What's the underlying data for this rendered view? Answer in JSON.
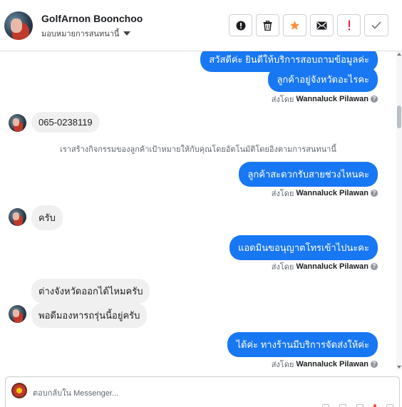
{
  "header": {
    "contact_name": "GolfArnon Boonchoo",
    "assign_label": "มอบหมายการสนทนานี้",
    "actions": [
      {
        "name": "flag-button",
        "glyph": "!",
        "icon": "alert-circle-icon"
      },
      {
        "name": "delete-button",
        "glyph": "🗑",
        "icon": "trash-icon"
      },
      {
        "name": "star-button",
        "glyph": "★",
        "icon": "star-icon"
      },
      {
        "name": "mark-unread-button",
        "glyph": "✉",
        "icon": "envelope-icon"
      },
      {
        "name": "spam-button",
        "glyph": "!",
        "icon": "exclamation-icon"
      },
      {
        "name": "done-button",
        "glyph": "✓",
        "icon": "check-icon"
      }
    ]
  },
  "messages": {
    "m1": "สวัสดีค่ะ  ยินดีให้บริการสอบถามข้อมูลค่ะ",
    "m2": "ลูกค้าอยู่จังหวัดอะไรคะ",
    "m3": "065-0238119",
    "system_note": "เราสร้างกิจกรรมของลูกค้าเป้าหมายให้กับคุณโดยอัตโนมัติโดยอิงตามการสนทนานี้",
    "m4": "ลูกค้าสะดวกรับสายช่วงไหนคะ",
    "m5": "ครับ",
    "m6": "แอดมินขอนุญาตโทรเข้าไปนะคะ",
    "m7": "ต่างจังหวัดออกได้ไหมครับ",
    "m8": "พอดีมองหารถรุ่นนี้อยู่ครับ",
    "m9": "ได้ค่ะ ทางร้านมีบริการจัดส่งให้ค่ะ"
  },
  "sent_by": {
    "prefix": "ส่งโดย",
    "agent": "Wannaluck Pilawan",
    "help_glyph": "?"
  },
  "composer": {
    "placeholder": "ตอบกลับใน Messenger..."
  },
  "colors": {
    "accent": "#1877f2",
    "incoming_bubble": "#f0f0f0",
    "star": "#f7923b",
    "spam": "#e41e3f"
  }
}
